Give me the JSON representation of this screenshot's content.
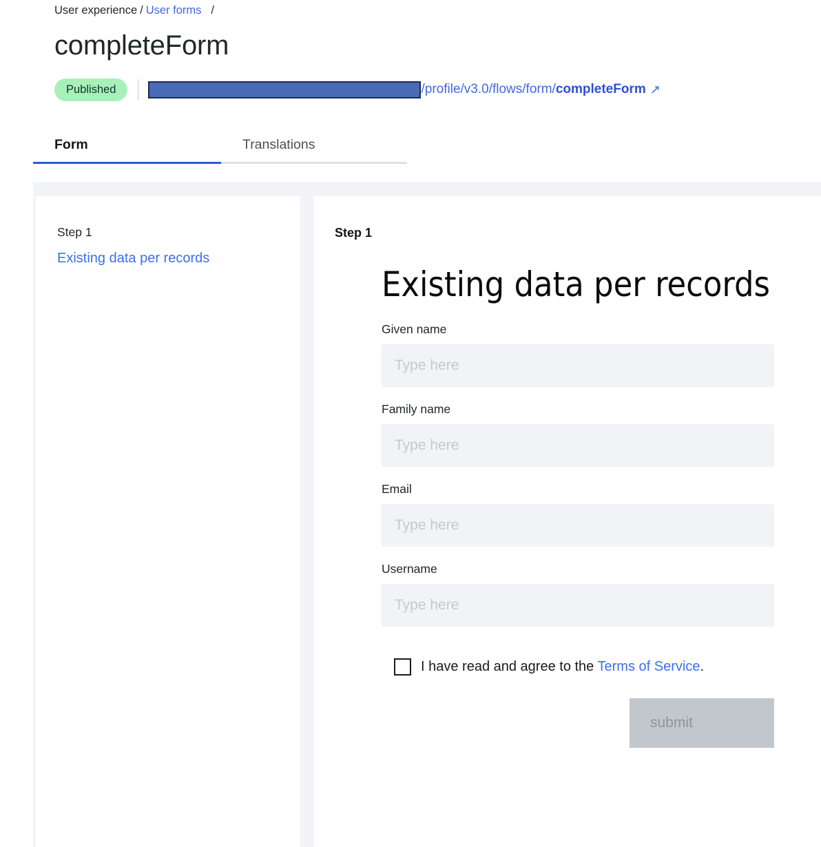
{
  "breadcrumb": {
    "root": "User experience",
    "separator": "/",
    "parent": "User forms",
    "trailing": "/"
  },
  "page": {
    "title": "completeForm"
  },
  "meta": {
    "status": "Published",
    "url": {
      "redacted_host": "",
      "path": "/profile/v3.0/flows/form/",
      "name": "completeForm",
      "external_icon": "↗"
    }
  },
  "tabs": [
    {
      "label": "Form",
      "active": true
    },
    {
      "label": "Translations",
      "active": false
    }
  ],
  "steps_panel": {
    "step_label": "Step 1",
    "step_link": "Existing data per records"
  },
  "preview": {
    "step_label": "Step 1",
    "heading": "Existing data per records",
    "fields": [
      {
        "label": "Given name",
        "value": "",
        "placeholder": "Type here"
      },
      {
        "label": "Family name",
        "value": "",
        "placeholder": "Type here"
      },
      {
        "label": "Email",
        "value": "",
        "placeholder": "Type here"
      },
      {
        "label": "Username",
        "value": "",
        "placeholder": "Type here"
      }
    ],
    "consent": {
      "text_before": "I have read and agree to the ",
      "link": "Terms of Service",
      "text_after": ".",
      "checked": false
    },
    "submit_label": "submit"
  },
  "colors": {
    "accent": "#3b6ef0",
    "tab_active_underline": "#2d5bd7",
    "badge_bg": "#a7f0ba",
    "panel_bg": "#f2f4f8",
    "input_bg": "#f1f3f7",
    "submit_bg": "#c1c7cd",
    "redaction": "#4a6cb8"
  }
}
